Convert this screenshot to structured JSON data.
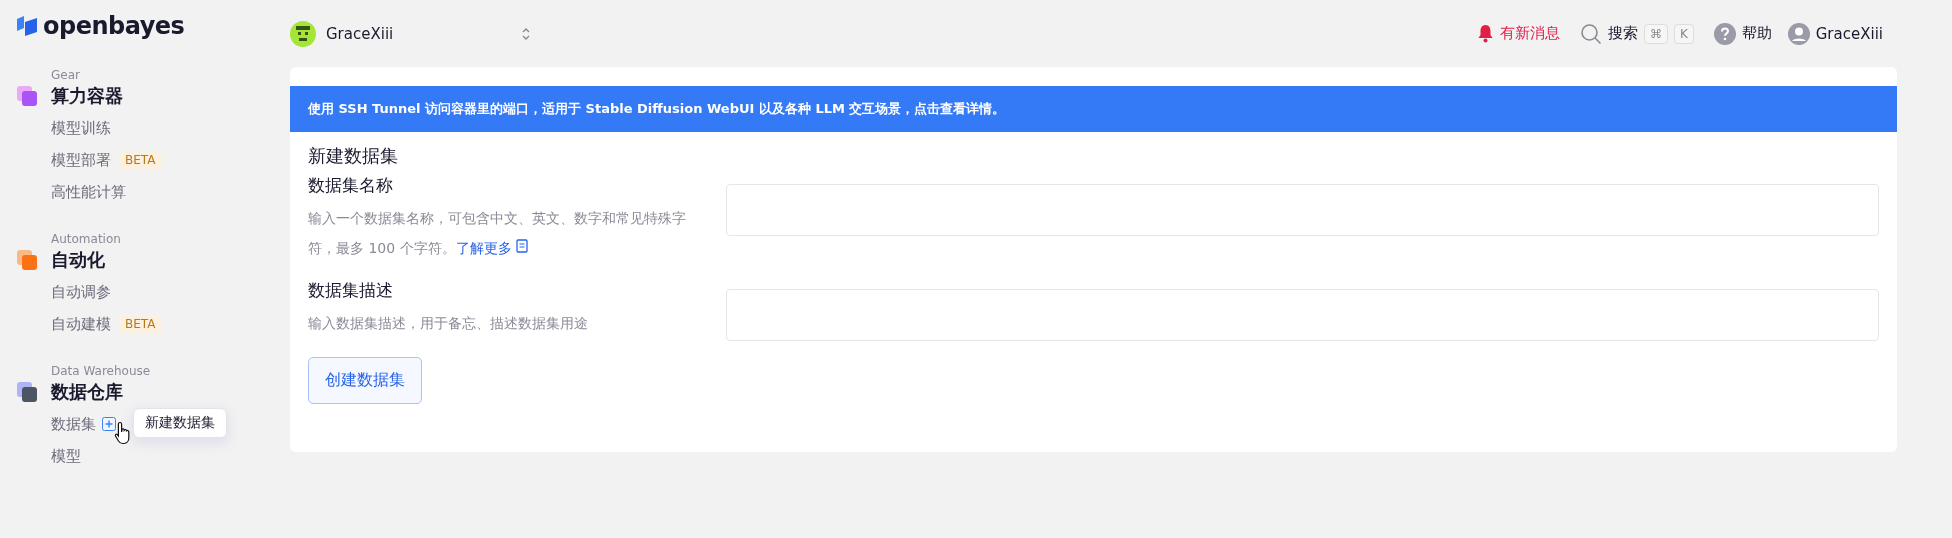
{
  "logo": {
    "text": "openbayes"
  },
  "sidebar": {
    "sections": [
      {
        "caption": "Gear",
        "title": "算力容器",
        "kind": "gear",
        "items": [
          {
            "label": "模型训练"
          },
          {
            "label": "模型部署",
            "badge": "BETA"
          },
          {
            "label": "高性能计算"
          }
        ]
      },
      {
        "caption": "Automation",
        "title": "自动化",
        "kind": "automation",
        "items": [
          {
            "label": "自动调参"
          },
          {
            "label": "自动建模",
            "badge": "BETA"
          }
        ]
      },
      {
        "caption": "Data Warehouse",
        "title": "数据仓库",
        "kind": "warehouse",
        "items": [
          {
            "label": "数据集",
            "add_tooltip": "新建数据集"
          },
          {
            "label": "模型"
          }
        ]
      }
    ]
  },
  "topbar": {
    "workspace": "GraceXiii",
    "notifications": "有新消息",
    "search": {
      "label": "搜索",
      "keys": [
        "⌘",
        "K"
      ]
    },
    "help": "帮助",
    "user": "GraceXiii"
  },
  "banner": "使用 SSH Tunnel 访问容器里的端口，适用于 Stable Diffusion WebUI 以及各种 LLM 交互场景，点击查看详情。",
  "form": {
    "title": "新建数据集",
    "fields": [
      {
        "label": "数据集名称",
        "help": "输入一个数据集名称，可包含中文、英文、数字和常见特殊字符，最多 100 个字符。",
        "link": "了解更多"
      },
      {
        "label": "数据集描述",
        "help": "输入数据集描述，用于备忘、描述数据集用途"
      }
    ],
    "submit": "创建数据集"
  }
}
